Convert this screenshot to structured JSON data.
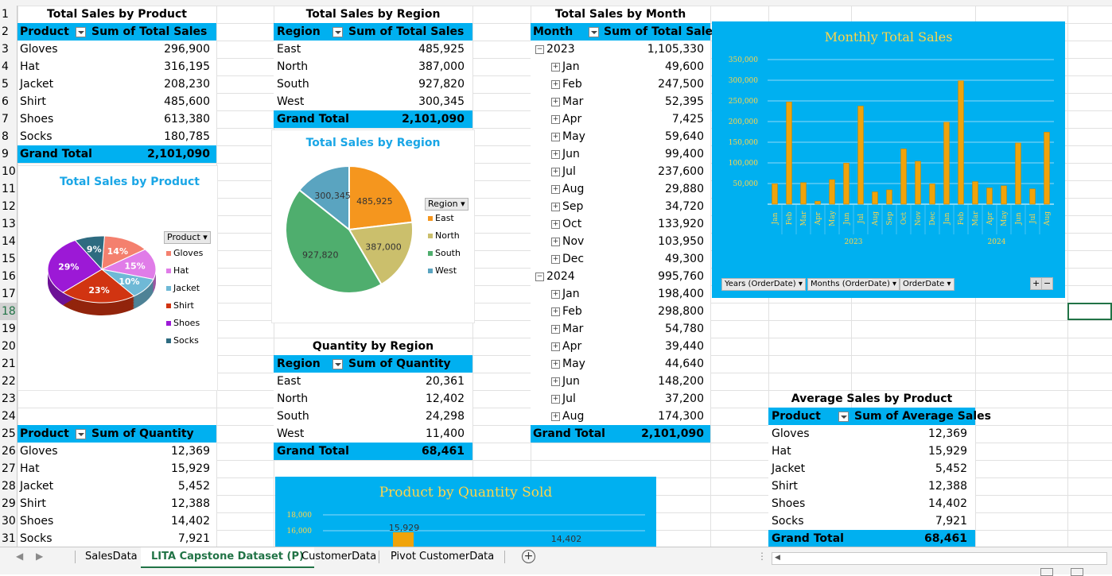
{
  "row_numbers": [
    "1",
    "2",
    "3",
    "4",
    "5",
    "6",
    "7",
    "8",
    "9",
    "10",
    "11",
    "12",
    "13",
    "14",
    "15",
    "16",
    "17",
    "18",
    "19",
    "20",
    "21",
    "22",
    "23",
    "24",
    "25",
    "26",
    "27",
    "28",
    "29",
    "30",
    "31"
  ],
  "product_table": {
    "title": "Total Sales by Product",
    "col1": "Product",
    "col2": "Sum of Total Sales",
    "rows": [
      {
        "label": "Gloves",
        "value": "296,900"
      },
      {
        "label": "Hat",
        "value": "316,195"
      },
      {
        "label": "Jacket",
        "value": "208,230"
      },
      {
        "label": "Shirt",
        "value": "485,600"
      },
      {
        "label": "Shoes",
        "value": "613,380"
      },
      {
        "label": "Socks",
        "value": "180,785"
      }
    ],
    "total_label": "Grand Total",
    "total_value": "2,101,090"
  },
  "region_table": {
    "title": "Total Sales by Region",
    "col1": "Region",
    "col2": "Sum of Total Sales",
    "rows": [
      {
        "label": "East",
        "value": "485,925"
      },
      {
        "label": "North",
        "value": "387,000"
      },
      {
        "label": "South",
        "value": "927,820"
      },
      {
        "label": "West",
        "value": "300,345"
      }
    ],
    "total_label": "Grand Total",
    "total_value": "2,101,090"
  },
  "month_table": {
    "title": "Total Sales by Month",
    "col1": "Month",
    "col2": "Sum of Total Sales",
    "rows": [
      {
        "label": "2023",
        "value": "1,105,330",
        "group": true,
        "sign": "−"
      },
      {
        "label": "Jan",
        "value": "49,600",
        "sign": "+"
      },
      {
        "label": "Feb",
        "value": "247,500",
        "sign": "+"
      },
      {
        "label": "Mar",
        "value": "52,395",
        "sign": "+"
      },
      {
        "label": "Apr",
        "value": "7,425",
        "sign": "+"
      },
      {
        "label": "May",
        "value": "59,640",
        "sign": "+"
      },
      {
        "label": "Jun",
        "value": "99,400",
        "sign": "+"
      },
      {
        "label": "Jul",
        "value": "237,600",
        "sign": "+"
      },
      {
        "label": "Aug",
        "value": "29,880",
        "sign": "+"
      },
      {
        "label": "Sep",
        "value": "34,720",
        "sign": "+"
      },
      {
        "label": "Oct",
        "value": "133,920",
        "sign": "+"
      },
      {
        "label": "Nov",
        "value": "103,950",
        "sign": "+"
      },
      {
        "label": "Dec",
        "value": "49,300",
        "sign": "+"
      },
      {
        "label": "2024",
        "value": "995,760",
        "group": true,
        "sign": "−"
      },
      {
        "label": "Jan",
        "value": "198,400",
        "sign": "+"
      },
      {
        "label": "Feb",
        "value": "298,800",
        "sign": "+"
      },
      {
        "label": "Mar",
        "value": "54,780",
        "sign": "+"
      },
      {
        "label": "Apr",
        "value": "39,440",
        "sign": "+"
      },
      {
        "label": "May",
        "value": "44,640",
        "sign": "+"
      },
      {
        "label": "Jun",
        "value": "148,200",
        "sign": "+"
      },
      {
        "label": "Jul",
        "value": "37,200",
        "sign": "+"
      },
      {
        "label": "Aug",
        "value": "174,300",
        "sign": "+"
      }
    ],
    "total_label": "Grand Total",
    "total_value": "2,101,090"
  },
  "quantity_region_table": {
    "title": "Quantity by Region",
    "col1": "Region",
    "col2": "Sum of Quantity",
    "rows": [
      {
        "label": "East",
        "value": "20,361"
      },
      {
        "label": "North",
        "value": "12,402"
      },
      {
        "label": "South",
        "value": "24,298"
      },
      {
        "label": "West",
        "value": "11,400"
      }
    ],
    "total_label": "Grand Total",
    "total_value": "68,461"
  },
  "quantity_product_table": {
    "col1": "Product",
    "col2": "Sum of Quantity",
    "rows": [
      {
        "label": "Gloves",
        "value": "12,369"
      },
      {
        "label": "Hat",
        "value": "15,929"
      },
      {
        "label": "Jacket",
        "value": "5,452"
      },
      {
        "label": "Shirt",
        "value": "12,388"
      },
      {
        "label": "Shoes",
        "value": "14,402"
      },
      {
        "label": "Socks",
        "value": "7,921"
      }
    ]
  },
  "avg_table": {
    "title": "Average Sales by Product",
    "col1": "Product",
    "col2": "Sum of Average Sales",
    "rows": [
      {
        "label": "Gloves",
        "value": "12,369"
      },
      {
        "label": "Hat",
        "value": "15,929"
      },
      {
        "label": "Jacket",
        "value": "5,452"
      },
      {
        "label": "Shirt",
        "value": "12,388"
      },
      {
        "label": "Shoes",
        "value": "14,402"
      },
      {
        "label": "Socks",
        "value": "7,921"
      }
    ],
    "total_label": "Grand Total",
    "total_value": "68,461"
  },
  "pie_product": {
    "title": "Total Sales by Product",
    "legend_title": "Product",
    "legend": [
      "Gloves",
      "Hat",
      "Jacket",
      "Shirt",
      "Shoes",
      "Socks"
    ],
    "labels": [
      "14%",
      "15%",
      "10%",
      "23%",
      "29%",
      "9%"
    ],
    "colors": [
      "#f4806e",
      "#e07ce8",
      "#6fb9d6",
      "#d13411",
      "#9c19d6",
      "#2e6b80"
    ]
  },
  "pie_region": {
    "title": "Total Sales by Region",
    "legend_title": "Region",
    "legend": [
      "East",
      "North",
      "South",
      "West"
    ],
    "labels": [
      "485,925",
      "387,000",
      "927,820",
      "300,345"
    ],
    "colors": [
      "#f5961e",
      "#cbbf6c",
      "#4fae6e",
      "#5aa4c0"
    ]
  },
  "chart_data": [
    {
      "type": "bar",
      "title": "Monthly Total Sales",
      "categories": [
        "Jan",
        "Feb",
        "Mar",
        "Apr",
        "May",
        "Jun",
        "Jul",
        "Aug",
        "Sep",
        "Oct",
        "Nov",
        "Dec",
        "Jan",
        "Feb",
        "Mar",
        "Apr",
        "May",
        "Jun",
        "Jul",
        "Aug"
      ],
      "groups": [
        {
          "label": "2023",
          "count": 12
        },
        {
          "label": "2024",
          "count": 8
        }
      ],
      "values": [
        49600,
        247500,
        52395,
        7425,
        59640,
        99400,
        237600,
        29880,
        34720,
        133920,
        103950,
        49300,
        198400,
        298800,
        54780,
        39440,
        44640,
        148200,
        37200,
        174300
      ],
      "yticks": [
        "50,000",
        "100,000",
        "150,000",
        "200,000",
        "250,000",
        "300,000",
        "350,000"
      ],
      "ylim": [
        0,
        350000
      ],
      "grid": true,
      "bar_color": "#f0a30a",
      "background": "#00b0f0",
      "filter_buttons": [
        "Years (OrderDate)",
        "Months (OrderDate)",
        "OrderDate"
      ]
    },
    {
      "type": "bar",
      "title": "Product by Quantity Sold",
      "yticks": [
        "16,000",
        "18,000"
      ],
      "visible_labels": [
        "15,929",
        "14,402"
      ],
      "background": "#00b0f0",
      "bar_color": "#f0a30a"
    },
    {
      "type": "pie",
      "title": "Total Sales by Product",
      "categories": [
        "Gloves",
        "Hat",
        "Jacket",
        "Shirt",
        "Shoes",
        "Socks"
      ],
      "values": [
        14,
        15,
        10,
        23,
        29,
        9
      ]
    },
    {
      "type": "pie",
      "title": "Total Sales by Region",
      "categories": [
        "East",
        "North",
        "South",
        "West"
      ],
      "values": [
        485925,
        387000,
        927820,
        300345
      ]
    }
  ],
  "sheet_tabs": [
    "SalesData",
    "LITA Capstone Dataset (P)",
    "CustomerData",
    "Pivot CustomerData"
  ],
  "active_tab": "LITA Capstone Dataset (P)",
  "add_sheet": "+"
}
